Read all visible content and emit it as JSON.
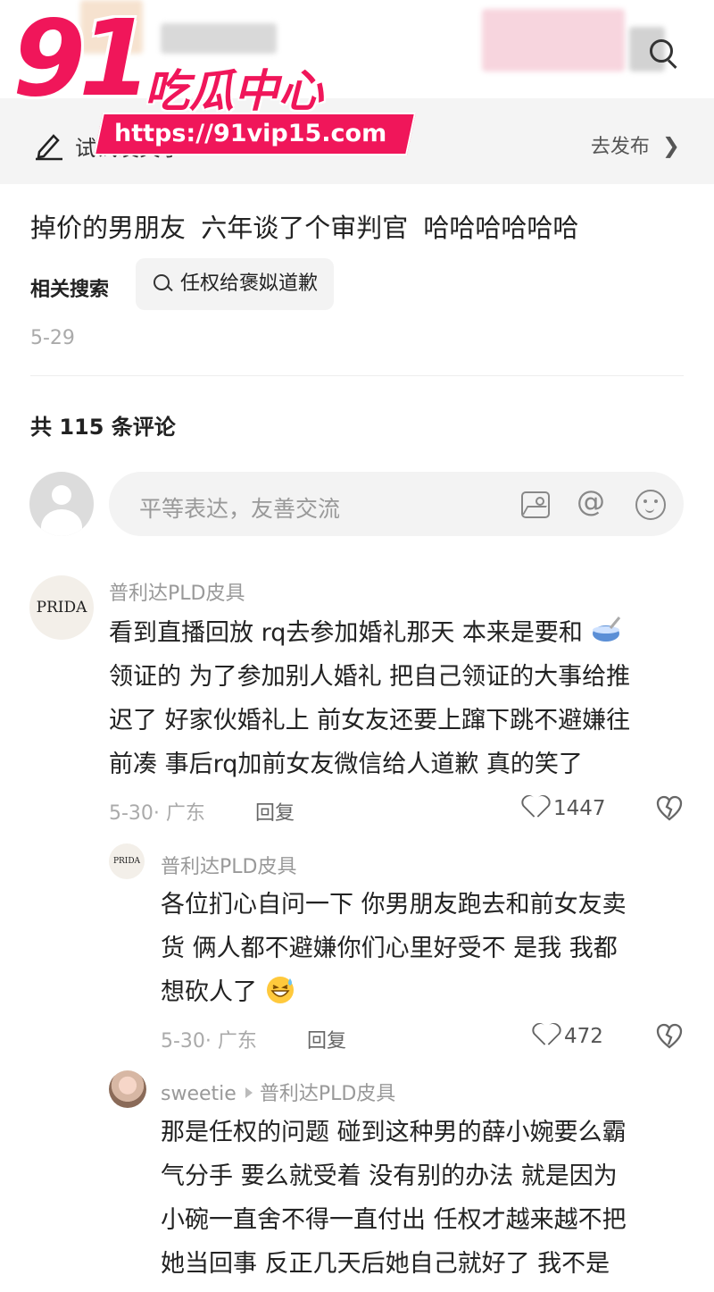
{
  "watermark": {
    "brand_number": "91",
    "brand_text": "吃瓜中心",
    "url": "https://91vip15.com"
  },
  "publish_bar": {
    "text": "试试发笑子",
    "publish_label": "去发布"
  },
  "post": {
    "title": "掉价的男朋友  六年谈了个审判官  哈哈哈哈哈哈",
    "related_label": "相关搜索",
    "related_query": "任权给褒姒道歉",
    "date": "5-29"
  },
  "comments_header": {
    "count_text": "共 115 条评论"
  },
  "comment_input": {
    "placeholder": "平等表达，友善交流"
  },
  "comments": [
    {
      "avatar_text": "PRIDA",
      "name": "普利达PLD皮具",
      "lines": [
        "看到直播回放 rq去参加婚礼那天 本来是要和",
        "领证的 为了参加别人婚礼 把自己领证的大事给推",
        "迟了 好家伙婚礼上 前女友还要上蹿下跳不避嫌往",
        "前凑 事后rq加前女友微信给人道歉 真的笑了"
      ],
      "meta": "5-30· 广东",
      "reply_label": "回复",
      "likes": "1447"
    },
    {
      "avatar_text": "PRIDA",
      "name": "普利达PLD皮具",
      "lines": [
        "各位扪心自问一下 你男朋友跑去和前女友卖",
        "货 俩人都不避嫌你们心里好受不 是我 我都",
        "想砍人了"
      ],
      "meta": "5-30· 广东",
      "reply_label": "回复",
      "likes": "472"
    },
    {
      "name": "sweetie",
      "reply_to": "普利达PLD皮具",
      "lines": [
        "那是任权的问题 碰到这种男的薛小婉要么霸",
        "气分手 要么就受着 没有别的办法 就是因为",
        "小碗一直舍不得一直付出 任权才越来越不把",
        "她当回事 反正几天后她自己就好了 我不是"
      ]
    }
  ],
  "colors": {
    "brand_pink": "#f0165a",
    "strip_bg": "#f4f4f4",
    "muted": "#999999"
  }
}
